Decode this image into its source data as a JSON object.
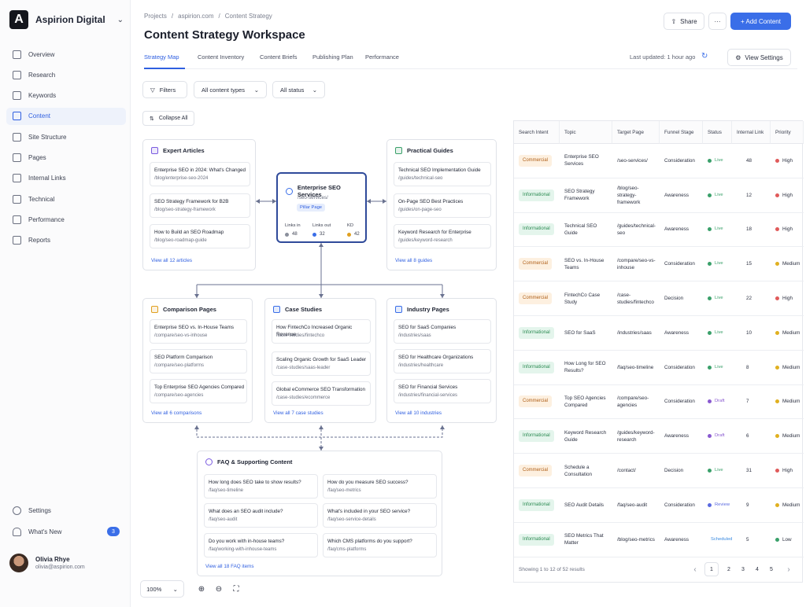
{
  "brand": {
    "logo": "A",
    "name": "Aspirion Digital"
  },
  "nav": [
    {
      "label": "Overview",
      "icon": "grid-icon"
    },
    {
      "label": "Research",
      "icon": "research-icon"
    },
    {
      "label": "Keywords",
      "icon": "keywords-icon"
    },
    {
      "label": "Content",
      "icon": "content-icon",
      "active": true
    },
    {
      "label": "Site Structure",
      "icon": "sitemap-icon"
    },
    {
      "label": "Pages",
      "icon": "pages-icon"
    },
    {
      "label": "Internal Links",
      "icon": "link-icon"
    },
    {
      "label": "Technical",
      "icon": "technical-icon"
    },
    {
      "label": "Performance",
      "icon": "chart-icon"
    },
    {
      "label": "Reports",
      "icon": "reports-icon"
    }
  ],
  "side_bottom": {
    "settings": "Settings",
    "whats_new": "What's New",
    "whats_new_count": "3"
  },
  "user": {
    "name": "Olivia Rhye",
    "email": "olivia@aspirion.com"
  },
  "breadcrumbs": [
    "Projects",
    "/",
    "aspirion.com",
    "/",
    "Content Strategy"
  ],
  "title": "Content Strategy Workspace",
  "header_buttons": {
    "share": "Share",
    "more": "···",
    "add": "+ Add Content"
  },
  "tabs": [
    "Strategy Map",
    "Content Inventory",
    "Content Briefs",
    "Publishing Plan",
    "Performance"
  ],
  "last_updated": "Last updated: 1 hour ago",
  "view_settings": "View Settings",
  "filters": {
    "filters": "Filters",
    "types": "All content types",
    "status": "All status"
  },
  "collapse_all": "Collapse All",
  "map": {
    "center": {
      "title": "Enterprise SEO Services",
      "path": "/seo-services/",
      "badge": "Pillar Page",
      "links_in_label": "Links in",
      "links_out_label": "Links out",
      "kd_label": "KD",
      "links_in": "48",
      "links_out": "32",
      "kd": "42"
    },
    "clusters": [
      {
        "title": "Expert Articles",
        "color": "#7a5ae0",
        "items": [
          {
            "t": "Enterprise SEO in 2024: What's Changed",
            "p": "/blog/enterprise-seo-2024"
          },
          {
            "t": "SEO Strategy Framework for B2B",
            "p": "/blog/seo-strategy-framework"
          },
          {
            "t": "How to Build an SEO Roadmap",
            "p": "/blog/seo-roadmap-guide"
          }
        ],
        "view": "View all 12 articles"
      },
      {
        "title": "Practical Guides",
        "color": "#3aa06a",
        "items": [
          {
            "t": "Technical SEO Implementation Guide",
            "p": "/guides/technical-seo"
          },
          {
            "t": "On-Page SEO Best Practices",
            "p": "/guides/on-page-seo"
          },
          {
            "t": "Keyword Research for Enterprise",
            "p": "/guides/keyword-research"
          }
        ],
        "view": "View all 8 guides"
      },
      {
        "title": "Comparison Pages",
        "color": "#e0a020",
        "items": [
          {
            "t": "Enterprise SEO vs. In-House Teams",
            "p": "/compare/seo-vs-inhouse"
          },
          {
            "t": "SEO Platform Comparison",
            "p": "/compare/seo-platforms"
          },
          {
            "t": "Top Enterprise SEO Agencies Compared",
            "p": "/compare/seo-agencies"
          }
        ],
        "view": "View all 6 comparisons"
      },
      {
        "title": "Case Studies",
        "color": "#3a6ee8",
        "items": [
          {
            "t": "How FintechCo Increased Organic Revenue",
            "p": "/case-studies/fintechco"
          },
          {
            "t": "Scaling Organic Growth for SaaS Leader",
            "p": "/case-studies/saas-leader"
          },
          {
            "t": "Global eCommerce SEO Transformation",
            "p": "/case-studies/ecommerce"
          }
        ],
        "view": "View all 7 case studies"
      },
      {
        "title": "Industry Pages",
        "color": "#3a6ee8",
        "items": [
          {
            "t": "SEO for SaaS Companies",
            "p": "/industries/saas"
          },
          {
            "t": "SEO for Healthcare Organizations",
            "p": "/industries/healthcare"
          },
          {
            "t": "SEO for Financial Services",
            "p": "/industries/financial-services"
          }
        ],
        "view": "View all 10 industries"
      }
    ],
    "faq": {
      "title": "FAQ & Supporting Content",
      "color": "#7a5ae0",
      "items": [
        {
          "t": "How long does SEO take to show results?",
          "p": "/faq/seo-timeline"
        },
        {
          "t": "How do you measure SEO success?",
          "p": "/faq/seo-metrics"
        },
        {
          "t": "What does an SEO audit include?",
          "p": "/faq/seo-audit"
        },
        {
          "t": "What's included in your SEO service?",
          "p": "/faq/seo-service-details"
        },
        {
          "t": "Do you work with in-house teams?",
          "p": "/faq/working-with-inhouse-teams"
        },
        {
          "t": "Which CMS platforms do you support?",
          "p": "/faq/cms-platforms"
        }
      ],
      "view": "View all 18 FAQ items"
    }
  },
  "table": {
    "headers": [
      "Search Intent",
      "Topic",
      "Target Page",
      "Funnel Stage",
      "Status",
      "Internal Link",
      "Priority"
    ],
    "rows": [
      {
        "intent": "Commercial",
        "topic": "Enterprise SEO Services",
        "page": "/seo-services/",
        "stage": "Consideration",
        "status": "Live",
        "links": "48",
        "priority": "High"
      },
      {
        "intent": "Informational",
        "topic": "SEO Strategy Framework",
        "page": "/blog/seo-strategy-framework",
        "stage": "Awareness",
        "status": "Live",
        "links": "12",
        "priority": "High"
      },
      {
        "intent": "Informational",
        "topic": "Technical SEO Guide",
        "page": "/guides/technical-seo",
        "stage": "Awareness",
        "status": "Live",
        "links": "18",
        "priority": "High"
      },
      {
        "intent": "Commercial",
        "topic": "SEO vs. In-House Teams",
        "page": "/compare/seo-vs-inhouse",
        "stage": "Consideration",
        "status": "Live",
        "links": "15",
        "priority": "Medium"
      },
      {
        "intent": "Commercial",
        "topic": "FintechCo Case Study",
        "page": "/case-studies/fintechco",
        "stage": "Decision",
        "status": "Live",
        "links": "22",
        "priority": "High"
      },
      {
        "intent": "Informational",
        "topic": "SEO for SaaS",
        "page": "/industries/saas",
        "stage": "Awareness",
        "status": "Live",
        "links": "10",
        "priority": "Medium"
      },
      {
        "intent": "Informational",
        "topic": "How Long for SEO Results?",
        "page": "/faq/seo-timeline",
        "stage": "Consideration",
        "status": "Live",
        "links": "8",
        "priority": "Medium"
      },
      {
        "intent": "Commercial",
        "topic": "Top SEO Agencies Compared",
        "page": "/compare/seo-agencies",
        "stage": "Consideration",
        "status": "Draft",
        "links": "7",
        "priority": "Medium"
      },
      {
        "intent": "Informational",
        "topic": "Keyword Research Guide",
        "page": "/guides/keyword-research",
        "stage": "Awareness",
        "status": "Draft",
        "links": "6",
        "priority": "Medium"
      },
      {
        "intent": "Commercial",
        "topic": "Schedule a Consultation",
        "page": "/contact/",
        "stage": "Decision",
        "status": "Live",
        "links": "31",
        "priority": "High"
      },
      {
        "intent": "Informational",
        "topic": "SEO Audit Details",
        "page": "/faq/seo-audit",
        "stage": "Consideration",
        "status": "Review",
        "links": "9",
        "priority": "Medium"
      },
      {
        "intent": "Informational",
        "topic": "SEO Metrics That Matter",
        "page": "/blog/seo-metrics",
        "stage": "Awareness",
        "status": "Scheduled",
        "links": "5",
        "priority": "Low"
      }
    ],
    "footer": "Showing 1 to 12 of 52 results",
    "pages": [
      "‹",
      "1",
      "2",
      "3",
      "4",
      "5",
      "›"
    ]
  },
  "colors": {
    "Live": "#3aa06a",
    "Draft": "#8a5ad0",
    "Review": "#5a6ae0",
    "Scheduled": "#3a8ae0",
    "High": "#e05a5a",
    "Medium": "#e0b020",
    "Low": "#3aa06a"
  },
  "zoom": {
    "level": "100%"
  }
}
